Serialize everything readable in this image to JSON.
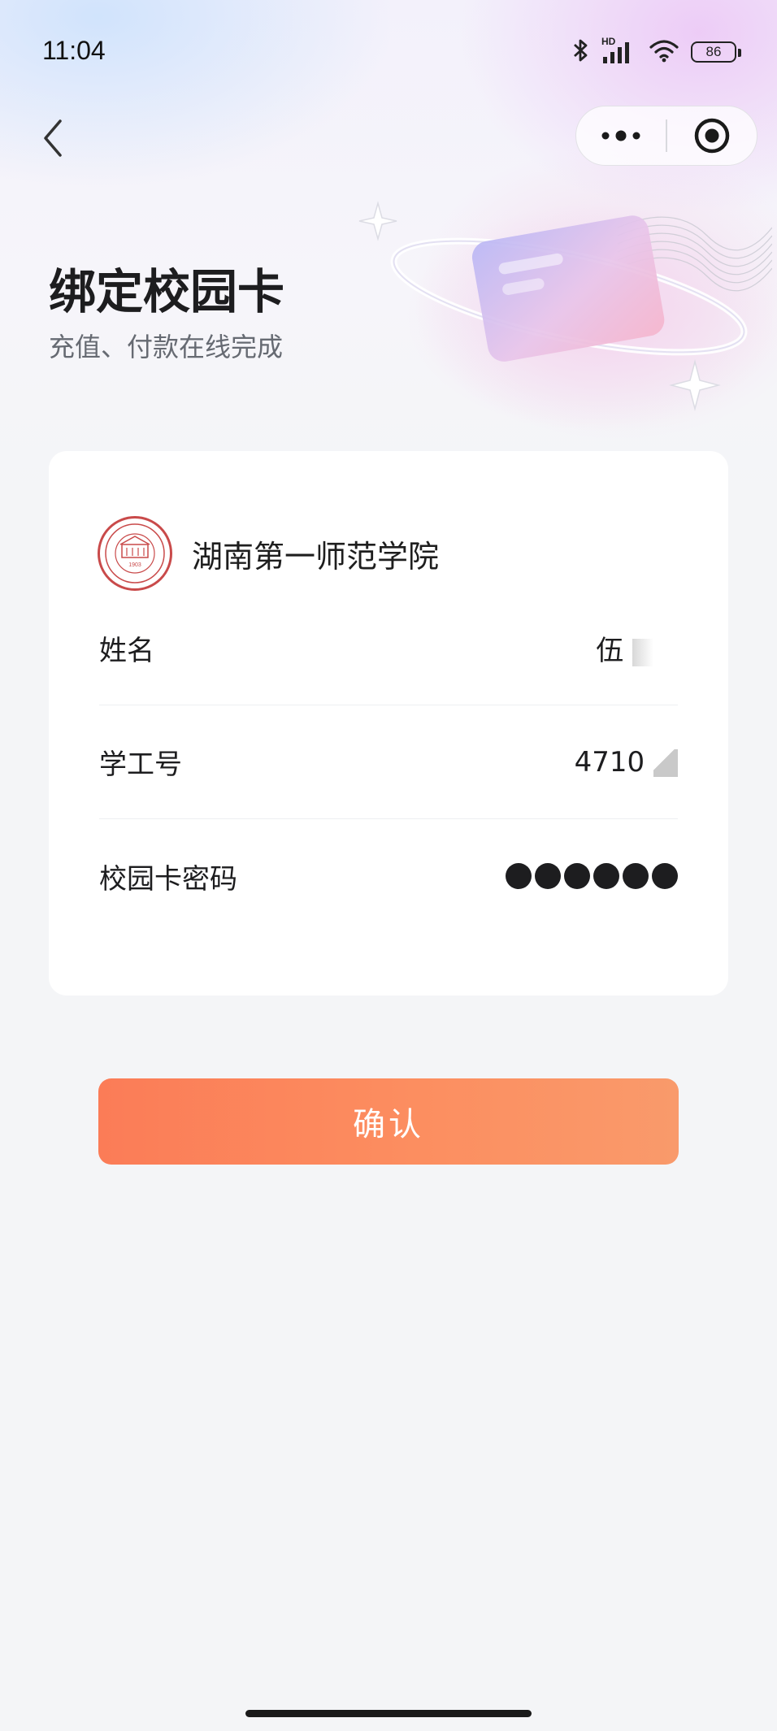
{
  "status_bar": {
    "time": "11:04",
    "battery": "86",
    "signal_label": "HD",
    "icons": [
      "bluetooth-icon",
      "signal-icon",
      "wifi-icon",
      "battery-icon"
    ]
  },
  "nav": {
    "back_icon": "chevron-left-icon",
    "more_icon": "more-dots-icon",
    "close_icon": "target-circle-icon"
  },
  "hero": {
    "title": "绑定校园卡",
    "subtitle": "充值、付款在线完成"
  },
  "school": {
    "name": "湖南第一师范学院",
    "logo_year": "1903"
  },
  "form": {
    "name_label": "姓名",
    "name_value": "伍",
    "id_label": "学工号",
    "id_value": "4710",
    "password_label": "校园卡密码",
    "password_dot_count": 6
  },
  "confirm_label": "确认",
  "colors": {
    "accent": "#fb7c57",
    "text": "#1d1d1f",
    "subtext": "#666a72",
    "logo_red": "#c94a4a"
  }
}
